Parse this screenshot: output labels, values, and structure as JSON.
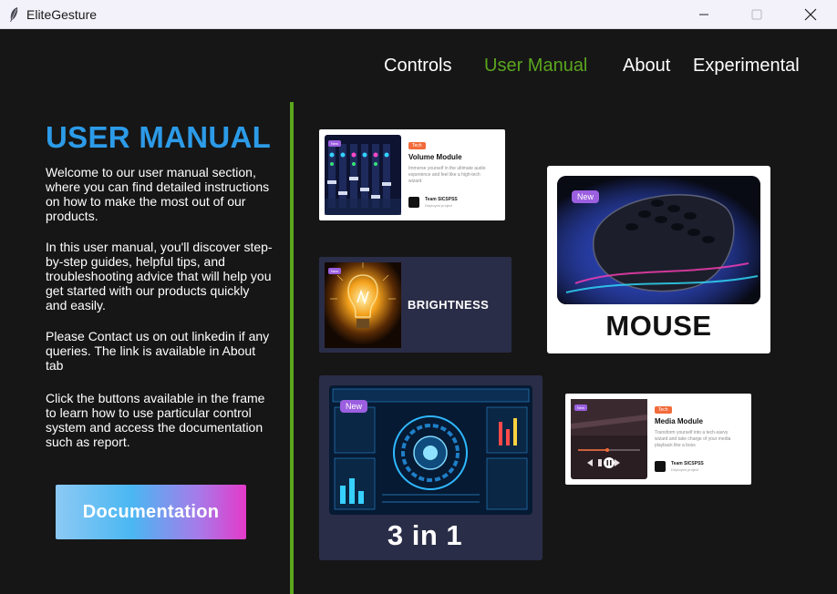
{
  "window": {
    "title": "EliteGesture"
  },
  "nav": {
    "controls": "Controls",
    "user_manual": "User Manual",
    "about": "About",
    "experimental": "Experimental",
    "active": "User Manual"
  },
  "manual": {
    "heading": "USER MANUAL",
    "paragraphs": [
      "Welcome to our user manual section, where you can find detailed instructions on how to make the most out of our products.",
      "In this user manual, you'll discover step-by-step guides, helpful tips, and troubleshooting advice that will help you get started with our products quickly and easily.",
      "Please Contact us on out linkedin if any queries. The link is available in About tab",
      "Click the buttons available in the frame to learn how to use particular control system and access the documentation such as report."
    ],
    "doc_button": "Documentation"
  },
  "cards": {
    "volume": {
      "badge": "New",
      "tag": "Tech",
      "title": "Volume Module",
      "desc": "Immerse yourself in the ultimate audio experience and feel like a high-tech wizard",
      "author": "Team SICSPSS",
      "author_sub": "Deployed project"
    },
    "brightness": {
      "badge": "New",
      "label": "BRIGHTNESS"
    },
    "mouse": {
      "badge": "New",
      "label": "MOUSE"
    },
    "three_in_one": {
      "badge": "New",
      "label": "3 in 1"
    },
    "media": {
      "badge": "New",
      "tag": "Tech",
      "title": "Media Module",
      "desc": "Transform yourself into a tech-savvy wizard and take charge of your media playback like a boss",
      "author": "Team SICSPSS",
      "author_sub": "Deployed project"
    }
  },
  "colors": {
    "background": "#161616",
    "accent_green": "#5aa61e",
    "heading_blue": "#2c9be8",
    "badge_purple": "#9b5fe0",
    "tag_orange": "#f26b3a",
    "card_navy": "#2a2d47"
  }
}
